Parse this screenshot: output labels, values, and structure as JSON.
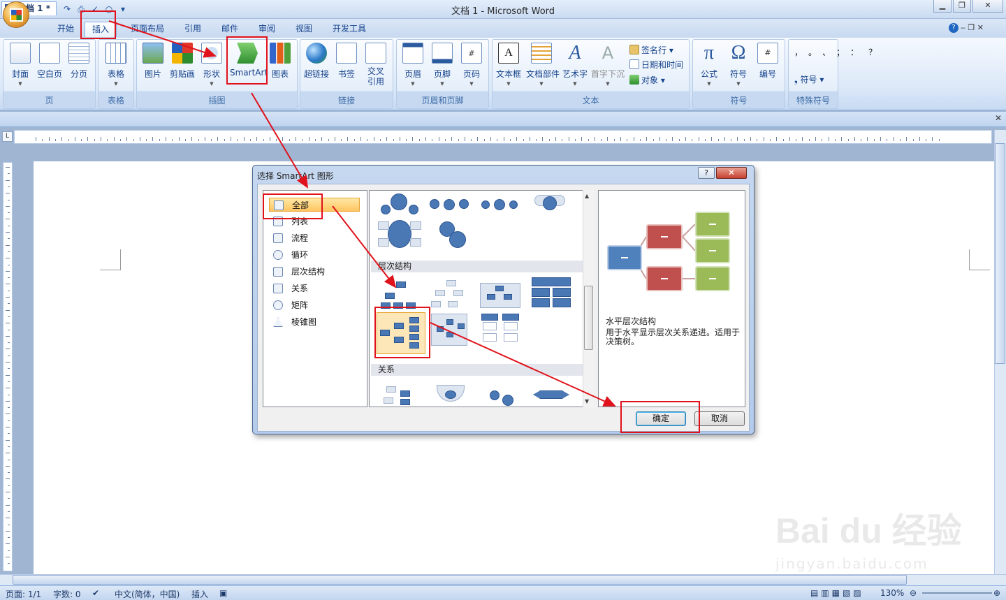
{
  "window": {
    "title": "文档 1 - Microsoft Word"
  },
  "tabs": [
    "开始",
    "插入",
    "页面布局",
    "引用",
    "邮件",
    "审阅",
    "视图",
    "开发工具"
  ],
  "ribbon": {
    "groups": [
      {
        "label": "页",
        "buttons": [
          "封面",
          "空白页",
          "分页"
        ]
      },
      {
        "label": "表格",
        "buttons": [
          "表格"
        ]
      },
      {
        "label": "插图",
        "buttons": [
          "图片",
          "剪贴画",
          "形状",
          "SmartArt",
          "图表"
        ]
      },
      {
        "label": "链接",
        "buttons": [
          "超链接",
          "书签",
          "交叉引用"
        ]
      },
      {
        "label": "页眉和页脚",
        "buttons": [
          "页眉",
          "页脚",
          "页码"
        ]
      },
      {
        "label": "文本",
        "buttons": [
          "文本框",
          "文档部件",
          "艺术字",
          "首字下沉"
        ],
        "small": [
          "签名行",
          "日期和时间",
          "对象"
        ]
      },
      {
        "label": "符号",
        "buttons": [
          "公式",
          "符号",
          "编号"
        ]
      },
      {
        "label": "特殊符号",
        "small": [
          "符号"
        ]
      }
    ]
  },
  "doc_tab": "文档 1 *",
  "dialog": {
    "title": "选择 SmartArt 图形",
    "categories": [
      "全部",
      "列表",
      "流程",
      "循环",
      "层次结构",
      "关系",
      "矩阵",
      "棱锥图"
    ],
    "section_headers": [
      "层次结构",
      "关系"
    ],
    "preview": {
      "title": "水平层次结构",
      "description": "用于水平显示层次关系递进。适用于决策树。"
    },
    "ok": "确定",
    "cancel": "取消"
  },
  "status": {
    "page": "页面: 1/1",
    "words": "字数: 0",
    "lang": "中文(简体，中国)",
    "mode": "插入",
    "zoom": "130%"
  },
  "watermark": {
    "brand": "Bai du 经验",
    "url": "jingyan.baidu.com"
  },
  "colors": {
    "accent_red": "#e0121b",
    "ribbon_blue": "#15428b",
    "node_blue": "#4a78b5",
    "node_red": "#c0504d",
    "node_green": "#9bbb59"
  }
}
